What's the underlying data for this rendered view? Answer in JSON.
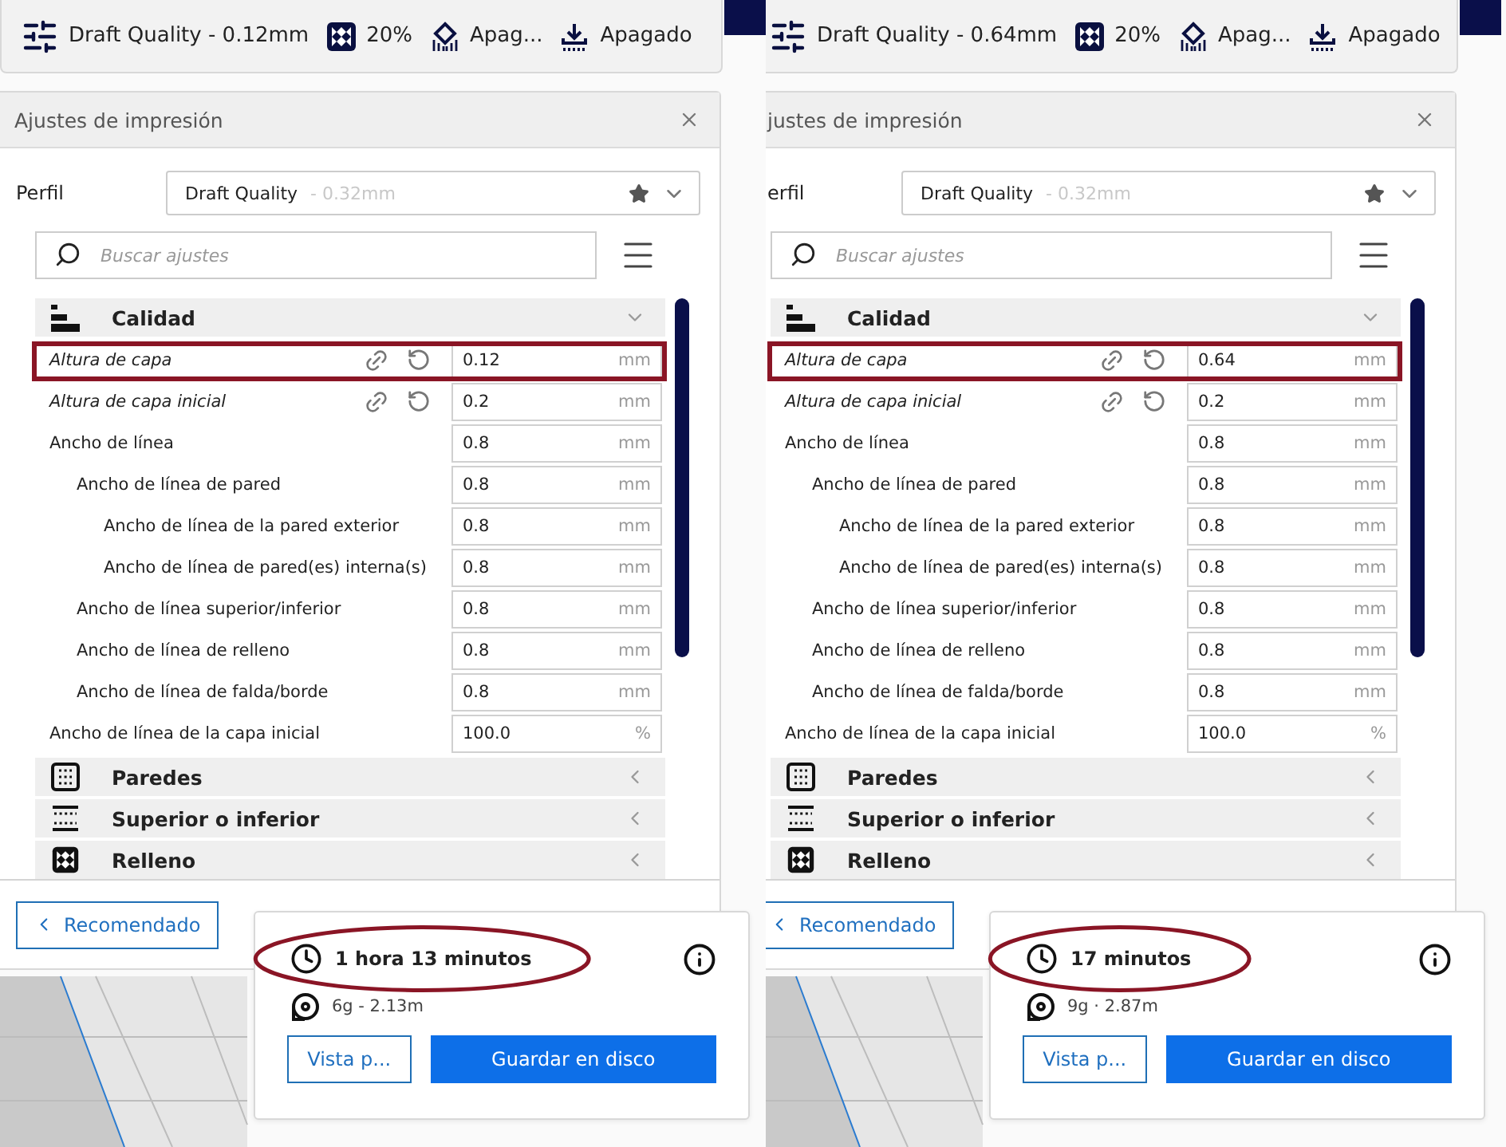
{
  "panels": [
    {
      "toolbar": {
        "items": [
          {
            "kind": "profile",
            "label": "Draft Quality - 0.12mm"
          },
          {
            "kind": "infill",
            "label": "20%"
          },
          {
            "kind": "support",
            "label": "Apag..."
          },
          {
            "kind": "adhesion",
            "label": "Apagado"
          }
        ]
      },
      "settings_panel": {
        "title": "Ajustes de impresión",
        "profile_label": "Perfil",
        "profile": {
          "name": "Draft Quality",
          "detail": "- 0.32mm"
        },
        "search": {
          "placeholder": "Buscar ajustes"
        },
        "categories": [
          {
            "kind": "quality",
            "name": "Calidad",
            "expanded": true,
            "settings": [
              {
                "label": "Altura de capa",
                "value": "0.12",
                "unit": "mm",
                "modified": true,
                "highlighted": true
              },
              {
                "label": "Altura de capa inicial",
                "value": "0.2",
                "unit": "mm",
                "modified": true,
                "highlighted": false
              },
              {
                "label": "Ancho de línea",
                "value": "0.8",
                "unit": "mm",
                "modified": false,
                "highlighted": false,
                "children": [
                  {
                    "label": "Ancho de línea de pared",
                    "value": "0.8",
                    "unit": "mm",
                    "modified": false,
                    "highlighted": false,
                    "children": [
                      {
                        "label": "Ancho de línea de la pared exterior",
                        "value": "0.8",
                        "unit": "mm",
                        "modified": false,
                        "highlighted": false
                      },
                      {
                        "label": "Ancho de línea de pared(es) interna(s)",
                        "value": "0.8",
                        "unit": "mm",
                        "modified": false,
                        "highlighted": false
                      }
                    ]
                  },
                  {
                    "label": "Ancho de línea superior/inferior",
                    "value": "0.8",
                    "unit": "mm",
                    "modified": false,
                    "highlighted": false
                  },
                  {
                    "label": "Ancho de línea de relleno",
                    "value": "0.8",
                    "unit": "mm",
                    "modified": false,
                    "highlighted": false
                  },
                  {
                    "label": "Ancho de línea de falda/borde",
                    "value": "0.8",
                    "unit": "mm",
                    "modified": false,
                    "highlighted": false
                  }
                ]
              },
              {
                "label": "Ancho de línea de la capa inicial",
                "value": "100.0",
                "unit": "%",
                "modified": false,
                "highlighted": false
              }
            ]
          },
          {
            "kind": "walls",
            "name": "Paredes",
            "expanded": false
          },
          {
            "kind": "topbottom",
            "name": "Superior o inferior",
            "expanded": false
          },
          {
            "kind": "infill",
            "name": "Relleno",
            "expanded": false
          }
        ],
        "footer_button": "Recomendado"
      },
      "summary": {
        "time": "1 hora 13 minutos",
        "time_highlighted": true,
        "material": "6g - 2.13m",
        "preview_button": "Vista p...",
        "save_button": "Guardar en disco"
      }
    },
    {
      "toolbar": {
        "items": [
          {
            "kind": "profile",
            "label": "Draft Quality - 0.64mm"
          },
          {
            "kind": "infill",
            "label": "20%"
          },
          {
            "kind": "support",
            "label": "Apag..."
          },
          {
            "kind": "adhesion",
            "label": "Apagado"
          }
        ]
      },
      "settings_panel": {
        "title": "justes de impresión",
        "profile_label": "erfil",
        "profile": {
          "name": "Draft Quality",
          "detail": "- 0.32mm"
        },
        "search": {
          "placeholder": "Buscar ajustes"
        },
        "categories": [
          {
            "kind": "quality",
            "name": "Calidad",
            "expanded": true,
            "settings": [
              {
                "label": "Altura de capa",
                "value": "0.64",
                "unit": "mm",
                "modified": true,
                "highlighted": true
              },
              {
                "label": "Altura de capa inicial",
                "value": "0.2",
                "unit": "mm",
                "modified": true,
                "highlighted": false
              },
              {
                "label": "Ancho de línea",
                "value": "0.8",
                "unit": "mm",
                "modified": false,
                "highlighted": false,
                "children": [
                  {
                    "label": "Ancho de línea de pared",
                    "value": "0.8",
                    "unit": "mm",
                    "modified": false,
                    "highlighted": false,
                    "children": [
                      {
                        "label": "Ancho de línea de la pared exterior",
                        "value": "0.8",
                        "unit": "mm",
                        "modified": false,
                        "highlighted": false
                      },
                      {
                        "label": "Ancho de línea de pared(es) interna(s)",
                        "value": "0.8",
                        "unit": "mm",
                        "modified": false,
                        "highlighted": false
                      }
                    ]
                  },
                  {
                    "label": "Ancho de línea superior/inferior",
                    "value": "0.8",
                    "unit": "mm",
                    "modified": false,
                    "highlighted": false
                  },
                  {
                    "label": "Ancho de línea de relleno",
                    "value": "0.8",
                    "unit": "mm",
                    "modified": false,
                    "highlighted": false
                  },
                  {
                    "label": "Ancho de línea de falda/borde",
                    "value": "0.8",
                    "unit": "mm",
                    "modified": false,
                    "highlighted": false
                  }
                ]
              },
              {
                "label": "Ancho de línea de la capa inicial",
                "value": "100.0",
                "unit": "%",
                "modified": false,
                "highlighted": false
              }
            ]
          },
          {
            "kind": "walls",
            "name": "Paredes",
            "expanded": false
          },
          {
            "kind": "topbottom",
            "name": "Superior o inferior",
            "expanded": false
          },
          {
            "kind": "infill",
            "name": "Relleno",
            "expanded": false
          }
        ],
        "footer_button": "Recomendado"
      },
      "summary": {
        "time": "17 minutos",
        "time_highlighted": true,
        "material": "9g · 2.87m",
        "preview_button": "Vista p...",
        "save_button": "Guardar en disco"
      }
    }
  ]
}
